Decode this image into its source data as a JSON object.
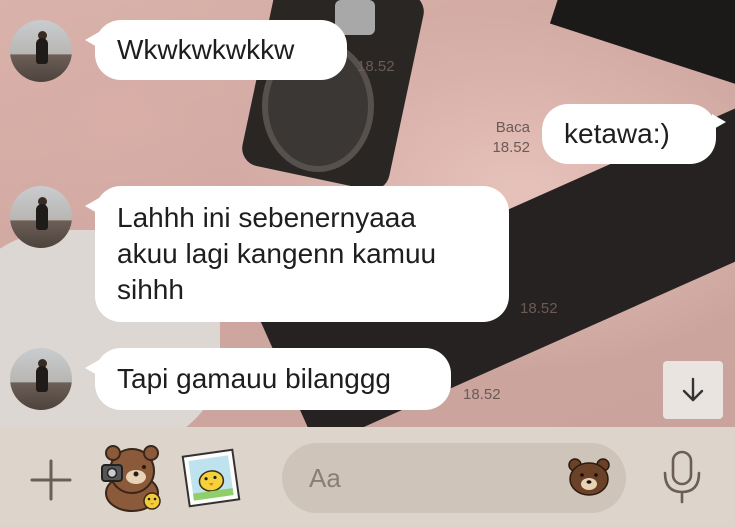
{
  "messages": [
    {
      "side": "left",
      "text": "Wkwkwkwkkw",
      "time": "18.52"
    },
    {
      "side": "right",
      "text": "ketawa:)",
      "read": "Baca",
      "time": "18.52"
    },
    {
      "side": "left",
      "lines": [
        "Lahhh ini sebenernyaaa",
        "akuu lagi kangenn kamuu",
        "sihhh"
      ],
      "time": "18.52"
    },
    {
      "side": "left",
      "text": "Tapi gamauu bilanggg",
      "time": "18.52"
    }
  ],
  "input": {
    "placeholder": "Aa"
  },
  "icons": {
    "add": "plus-icon",
    "sticker": "bear-sticker-icon",
    "photo": "photo-sticker-icon",
    "emoji": "bear-face-icon",
    "mic": "microphone-icon",
    "scroll": "arrow-down-icon"
  },
  "colors": {
    "bubble": "#ffffff",
    "bottom_bar": "#ddd4cb",
    "input_bg": "#cfc4ba",
    "text": "#1e1e1e"
  }
}
